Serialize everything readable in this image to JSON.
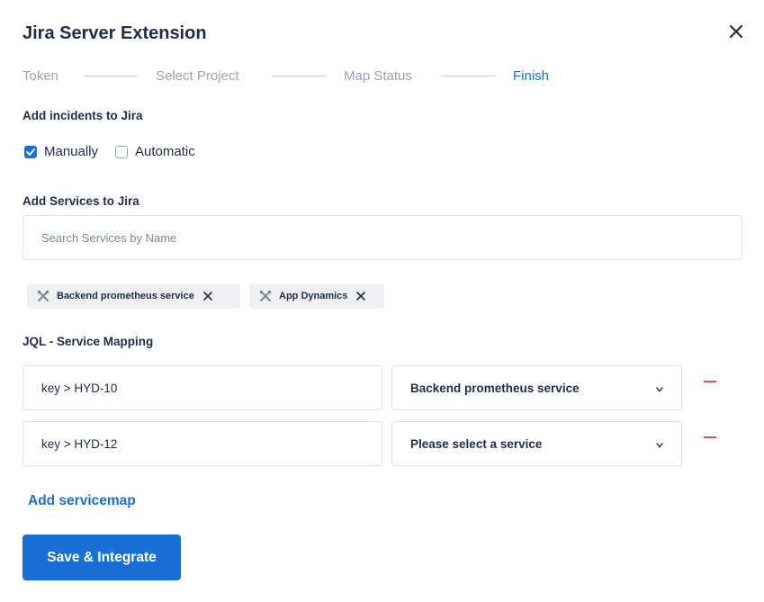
{
  "dialog": {
    "title": "Jira Server Extension",
    "close_icon": "close-icon"
  },
  "steps": [
    {
      "label": "Token",
      "active": false
    },
    {
      "label": "Select Project",
      "active": false
    },
    {
      "label": "Map Status",
      "active": false
    },
    {
      "label": "Finish",
      "active": true
    }
  ],
  "incidents": {
    "label": "Add incidents to Jira",
    "options": [
      {
        "label": "Manually",
        "checked": true
      },
      {
        "label": "Automatic",
        "checked": false
      }
    ]
  },
  "services": {
    "label": "Add Services to Jira",
    "search_placeholder": "Search Services by Name",
    "search_value": "",
    "selected": [
      {
        "label": "Backend prometheus service",
        "icon": "tools-icon"
      },
      {
        "label": "App Dynamics",
        "icon": "tools-icon"
      }
    ]
  },
  "mapping": {
    "label": "JQL - Service Mapping",
    "rows": [
      {
        "jql": "key > HYD-10",
        "service": "Backend prometheus service"
      },
      {
        "jql": "key > HYD-12",
        "service": "Please select a service"
      }
    ]
  },
  "actions": {
    "add_servicemap": "Add servicemap",
    "save": "Save & Integrate"
  },
  "colors": {
    "accent": "#1a6fd6",
    "text": "#1f2d4a",
    "muted": "#9aa3b2",
    "remove": "#e2543c"
  }
}
